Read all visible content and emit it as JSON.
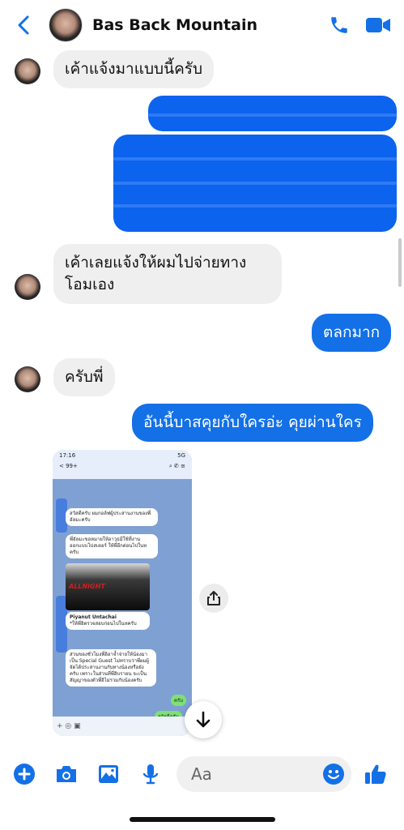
{
  "header": {
    "contact_name": "Bas Back Mountain"
  },
  "messages": [
    {
      "side": "in",
      "text": "เค้าแจ้งมาแบบนี้ครับ"
    },
    {
      "side": "in",
      "text_line1": "เค้าเลยแจ้งให้ผมไปจ่ายทาง",
      "text_line2": "โอมเอง"
    },
    {
      "side": "out",
      "text": "ตลกมาก"
    },
    {
      "side": "in",
      "text": "ครับพี่"
    },
    {
      "side": "out",
      "text": "อันนี้บาสคุยกับใครอ่ะ คุยผ่านใคร"
    }
  ],
  "attachment": {
    "status_time": "17:16",
    "status_net": "5G",
    "chat_back": "< 99+",
    "msg1": "สวัสดีครับ ผมกอล์ฟผู้ประสานงานของพี่อัลมะครับ",
    "msg2": "พี่อัลมะขอหมายให้อาวุธมีใช้ที่งานออกแบบโปสเตอร์ ให้พี่อีกต่อนไปในหครับ",
    "image_caption": "ALLNIGHT",
    "msg3_name": "Piyanut Untachai",
    "msg3": "*ให้พี่อิตรวจสอบก่อนไปในหครับ",
    "msg4": "ส่วนของชั่วโมงพี่อิอาจ้ำจ่ายให้น้องมาเป็น Special Guest ไม่ทราบว่าพี่ผมผู้จัดได้ประสานงานกับทางน้องหรือยังครับ เพราะในส่วนที่พี่อิบรายน จะเป็นสัญญาของตัวพี่อิไม่รวมกับน้องครับ",
    "reply1": "ครับ",
    "reply2": "สวัสดีครับ"
  },
  "composer": {
    "placeholder": "Aa"
  },
  "colors": {
    "accent": "#1370e6",
    "incoming_bubble": "#efefef",
    "outgoing_bubble": "#1370e6"
  },
  "icons": [
    "back-chevron-icon",
    "phone-icon",
    "video-camera-icon",
    "share-icon",
    "arrow-down-icon",
    "plus-circle-icon",
    "camera-icon",
    "image-icon",
    "microphone-icon",
    "emoji-icon",
    "thumbs-up-icon"
  ]
}
